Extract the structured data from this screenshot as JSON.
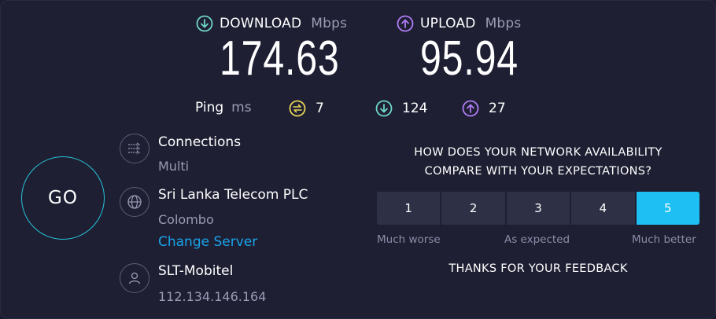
{
  "download": {
    "label": "DOWNLOAD",
    "unit": "Mbps",
    "value": "174.63",
    "color": "#6fd6c6"
  },
  "upload": {
    "label": "UPLOAD",
    "unit": "Mbps",
    "value": "95.94",
    "color": "#b07cf5"
  },
  "ping": {
    "label": "Ping",
    "unit": "ms",
    "idle": "7",
    "download": "124",
    "upload": "27",
    "idle_color": "#e8d35a"
  },
  "go_label": "GO",
  "connections": {
    "title": "Connections",
    "value": "Multi"
  },
  "server": {
    "name": "Sri Lanka Telecom PLC",
    "location": "Colombo",
    "change_label": "Change Server"
  },
  "isp": {
    "name": "SLT-Mobitel",
    "ip": "112.134.146.164"
  },
  "survey": {
    "question_line1": "HOW DOES YOUR NETWORK AVAILABILITY",
    "question_line2": "COMPARE WITH YOUR EXPECTATIONS?",
    "options": [
      "1",
      "2",
      "3",
      "4",
      "5"
    ],
    "selected": "5",
    "scale_low": "Much worse",
    "scale_mid": "As expected",
    "scale_high": "Much better",
    "thanks": "THANKS FOR YOUR FEEDBACK"
  },
  "colors": {
    "accent": "#1ec0f3",
    "go_ring": "#27c3d8",
    "link": "#1aa3e8",
    "background": "#1e1f33"
  }
}
